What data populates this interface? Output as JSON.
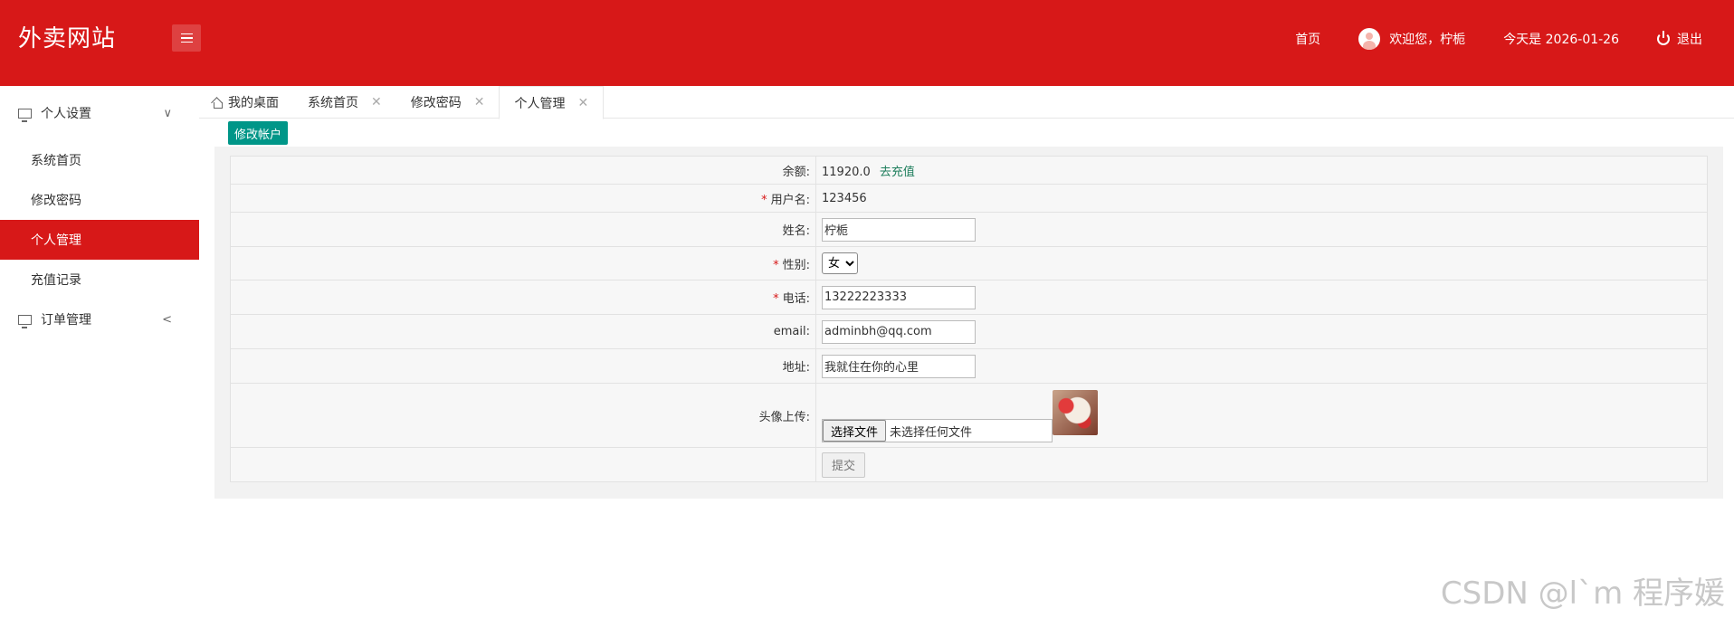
{
  "app": {
    "title": "外卖网站"
  },
  "header": {
    "home_label": "首页",
    "welcome_text": "欢迎您，柠栀",
    "date_text": "今天是 2026-01-26",
    "logout_label": "退出",
    "accent_color": "#d71818"
  },
  "sidebar": {
    "groups": [
      {
        "label": "个人设置",
        "chevron": "∨",
        "items": [
          "系统首页",
          "修改密码",
          "个人管理",
          "充值记录"
        ]
      },
      {
        "label": "订单管理",
        "chevron": "<"
      }
    ],
    "active_item": "个人管理"
  },
  "tabs": [
    {
      "label": "我的桌面"
    },
    {
      "label": "系统首页"
    },
    {
      "label": "修改密码"
    },
    {
      "label": "个人管理"
    }
  ],
  "form": {
    "edit_button": "修改帐户",
    "balance_label": "余额:",
    "balance_value": "11920.0",
    "recharge_link": "去充值",
    "username_label": "用户名:",
    "username_value": "123456",
    "name_label": "姓名:",
    "name_value": "柠栀",
    "gender_label": "性别:",
    "gender_value": "女",
    "phone_label": "电话:",
    "phone_value": "13222223333",
    "email_label": "email:",
    "email_value": "adminbh@qq.com",
    "address_label": "地址:",
    "address_value": "我就住在你的心里",
    "avatar_label": "头像上传:",
    "file_button": "选择文件",
    "file_status": "未选择任何文件",
    "submit_button": "提交",
    "required_mark": "*"
  },
  "watermark": "CSDN @l`m 程序媛"
}
